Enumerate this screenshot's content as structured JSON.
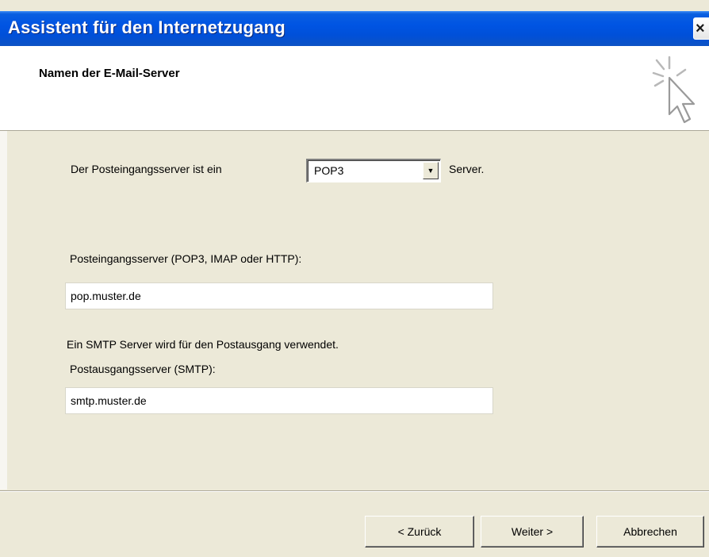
{
  "window": {
    "title": "Assistent für den Internetzugang",
    "close_glyph": "×"
  },
  "header": {
    "title": "Namen der E-Mail-Server",
    "icon": "wizard-sparkle-cursor-icon"
  },
  "form": {
    "incoming_type_prefix": "Der Posteingangsserver ist ein",
    "incoming_type_value": "POP3",
    "incoming_type_suffix": "Server.",
    "incoming_label": "Posteingangsserver (POP3, IMAP oder HTTP):",
    "incoming_value": "pop.muster.de",
    "smtp_info": "Ein SMTP Server wird für den Postausgang verwendet.",
    "outgoing_label": "Postausgangsserver (SMTP):",
    "outgoing_value": "smtp.muster.de"
  },
  "buttons": {
    "back": "< Zurück",
    "next": "Weiter >",
    "cancel": "Abbrechen"
  },
  "colors": {
    "titlebar": "#0054e3",
    "dialog_face": "#ece9d8",
    "header_bg": "#ffffff"
  }
}
